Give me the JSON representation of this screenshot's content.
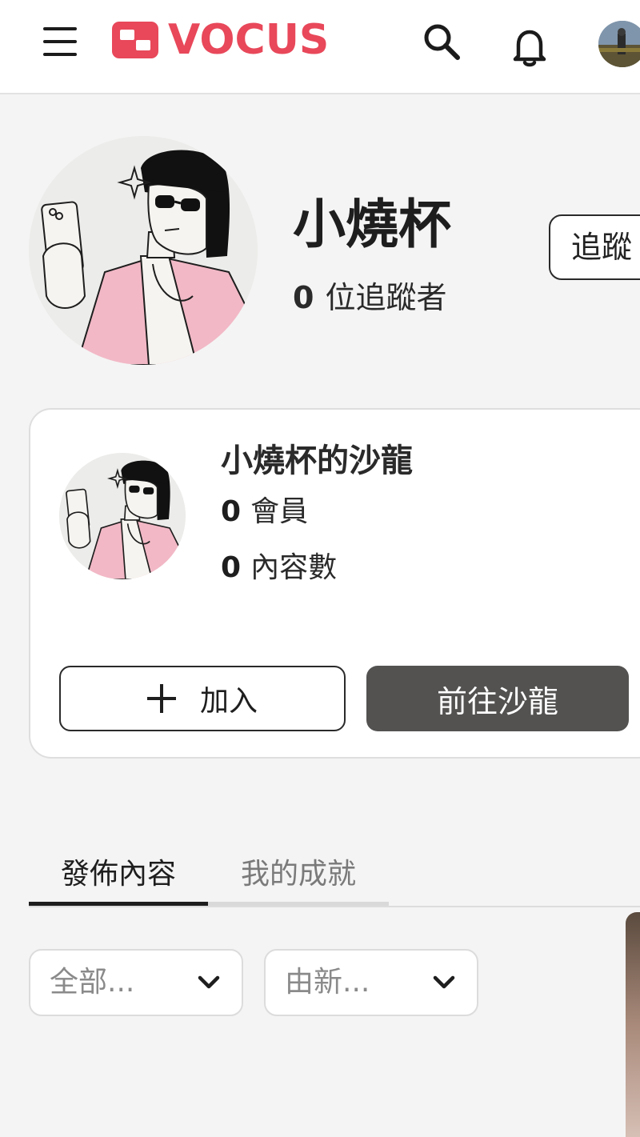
{
  "header": {
    "brand": "VOCUS",
    "icons": {
      "menu": "hamburger-menu-icon",
      "logo": "vocus-logo-icon",
      "search": "search-icon",
      "notifications": "bell-icon",
      "user": "user-avatar"
    },
    "brand_color": "#e8485a"
  },
  "profile": {
    "name": "小燒杯",
    "followers_count": "0",
    "followers_label": "位追蹤者",
    "follow_button": "追蹤"
  },
  "salon": {
    "title": "小燒杯的沙龍",
    "members_count": "0",
    "members_label": "會員",
    "content_count": "0",
    "content_label": "內容數",
    "join_button": "加入",
    "goto_button": "前往沙龍",
    "goto_button_color": "#535251"
  },
  "tabs": [
    {
      "label": "發佈內容",
      "active": true
    },
    {
      "label": "我的成就",
      "active": false
    }
  ],
  "filters": {
    "category": "全部...",
    "sort": "由新..."
  }
}
